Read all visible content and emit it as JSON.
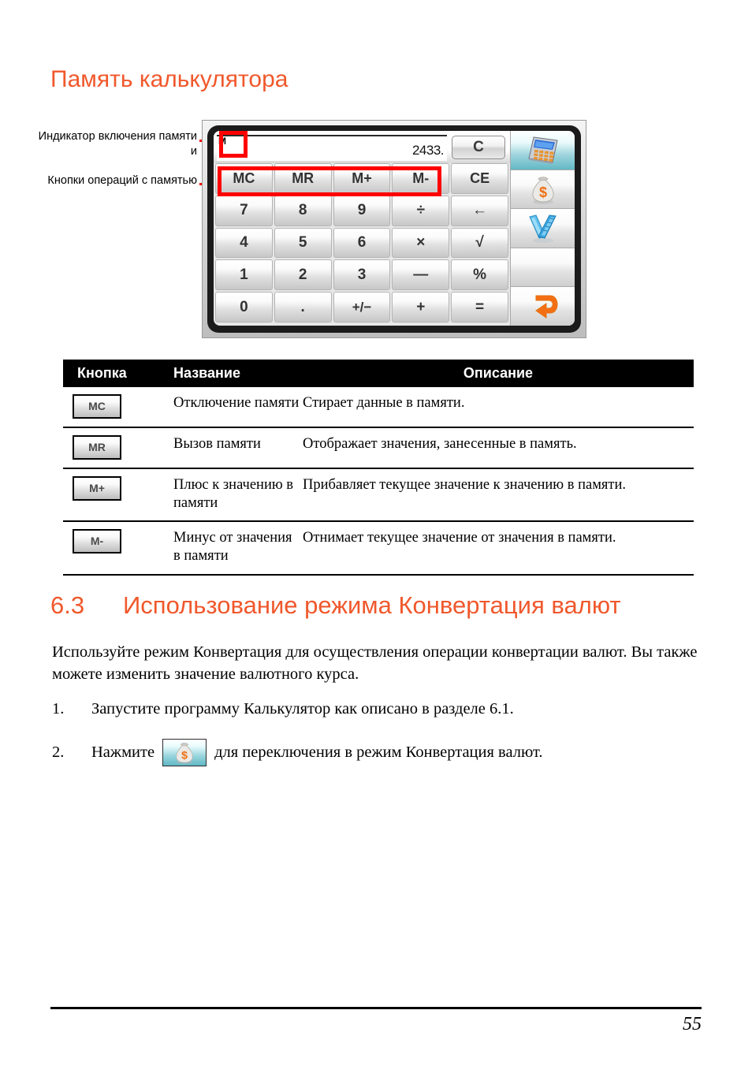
{
  "page": {
    "heading": "Память калькулятора",
    "number": "55"
  },
  "callouts": [
    {
      "name": "memory-indicator",
      "text": "Индикатор включения памяти и"
    },
    {
      "name": "memory-operation-keys",
      "text": "Кнопки операций с памятью"
    }
  ],
  "calculator": {
    "display": {
      "memory_indicator": "M",
      "value": "2433."
    },
    "clear_label": "C",
    "keys": [
      [
        "MC",
        "MR",
        "M+",
        "M-",
        "CE"
      ],
      [
        "7",
        "8",
        "9",
        "÷",
        "←"
      ],
      [
        "4",
        "5",
        "6",
        "×",
        "√"
      ],
      [
        "1",
        "2",
        "3",
        "—",
        "%"
      ],
      [
        "0",
        ".",
        "+/−",
        "+",
        "="
      ]
    ],
    "side_buttons": [
      {
        "name": "calculator-mode-icon",
        "selected": true
      },
      {
        "name": "currency-mode-icon",
        "selected": false
      },
      {
        "name": "unit-converter-mode-icon",
        "selected": false
      },
      {
        "name": "blank-button",
        "selected": false
      },
      {
        "name": "back-arrow-icon",
        "selected": false
      }
    ]
  },
  "table": {
    "headers": [
      "Кнопка",
      "Название",
      "Описание"
    ],
    "rows": [
      {
        "button": "MC",
        "name": "Отключение памяти",
        "description": "Стирает данные в памяти."
      },
      {
        "button": "MR",
        "name": "Вызов памяти",
        "description": "Отображает значения, занесенные в память."
      },
      {
        "button": "M+",
        "name": "Плюс к значению в памяти",
        "description": "Прибавляет текущее значение к значению в памяти."
      },
      {
        "button": "M-",
        "name": "Минус от значения в памяти",
        "description": "Отнимает текущее значение от значения в памяти."
      }
    ]
  },
  "section": {
    "number": "6.3",
    "title": "Использование режима Конвертация валют",
    "paragraph": "Используйте режим Конвертация для осуществления операции конвертации валют. Вы также можете изменить значение валютного курса.",
    "steps": [
      {
        "num": "1.",
        "text": "Запустите программу Калькулятор как описано в разделе 6.1.",
        "text_before": "",
        "text_after": "",
        "has_icon": false
      },
      {
        "num": "2.",
        "text": "",
        "text_before": "Нажмите",
        "text_after": "для переключения в режим Конвертация валют.",
        "has_icon": true
      }
    ]
  },
  "colors": {
    "accent_orange": "#F0582C",
    "highlight_red": "#FF0000",
    "header_bar": "#000000"
  }
}
